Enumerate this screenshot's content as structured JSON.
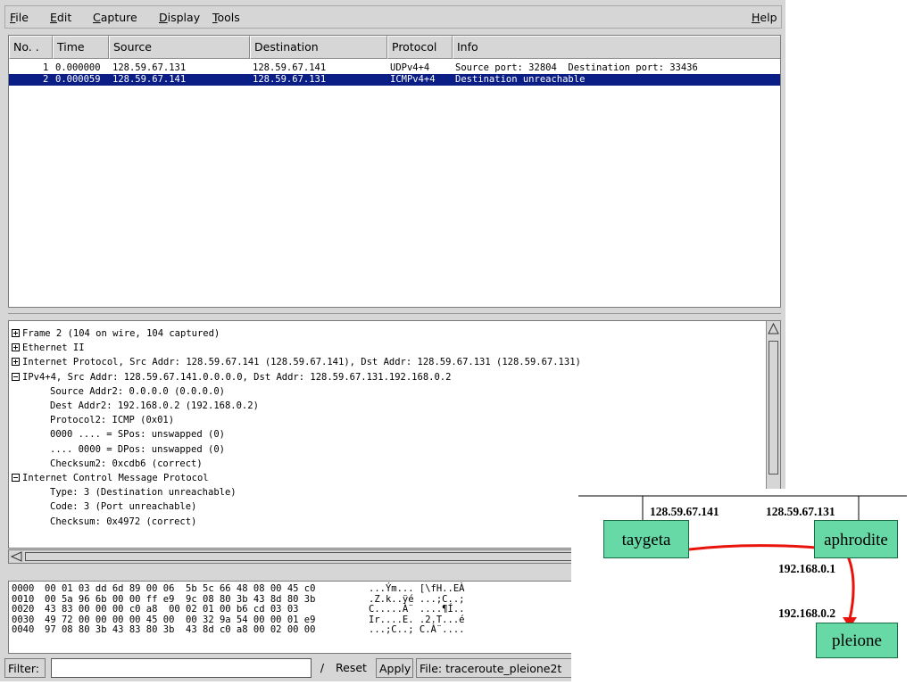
{
  "menubar": {
    "items": [
      {
        "label": "File",
        "key": "F",
        "rest": "ile"
      },
      {
        "label": "Edit",
        "key": "E",
        "rest": "dit"
      },
      {
        "label": "Capture",
        "key": "C",
        "rest": "apture"
      },
      {
        "label": "Display",
        "key": "D",
        "rest": "isplay"
      },
      {
        "label": "Tools",
        "key": "T",
        "rest": "ools"
      }
    ],
    "help": {
      "label": "Help",
      "key": "H",
      "rest": "elp"
    }
  },
  "packet_list": {
    "columns": [
      "No. .",
      "Time",
      "Source",
      "Destination",
      "Protocol",
      "Info"
    ],
    "rows": [
      {
        "no": "1",
        "time": "0.000000",
        "source": "128.59.67.131",
        "destination": "128.59.67.141",
        "protocol": "UDPv4+4",
        "info": "Source port: 32804  Destination port: 33436",
        "selected": false
      },
      {
        "no": "2",
        "time": "0.000059",
        "source": "128.59.67.141",
        "destination": "128.59.67.131",
        "protocol": "ICMPv4+4",
        "info": "Destination unreachable",
        "selected": true
      }
    ]
  },
  "details": {
    "lines": [
      {
        "toggle": "plus",
        "text": "Frame 2 (104 on wire, 104 captured)"
      },
      {
        "toggle": "plus",
        "text": "Ethernet II"
      },
      {
        "toggle": "plus",
        "text": "Internet Protocol, Src Addr: 128.59.67.141 (128.59.67.141), Dst Addr: 128.59.67.131 (128.59.67.131)"
      },
      {
        "toggle": "minus",
        "text": "IPv4+4, Src Addr: 128.59.67.141.0.0.0.0, Dst Addr: 128.59.67.131.192.168.0.2"
      },
      {
        "toggle": "",
        "text": "Source Addr2: 0.0.0.0 (0.0.0.0)"
      },
      {
        "toggle": "",
        "text": "Dest Addr2: 192.168.0.2 (192.168.0.2)"
      },
      {
        "toggle": "",
        "text": "Protocol2: ICMP (0x01)"
      },
      {
        "toggle": "",
        "text": "0000 .... = SPos: unswapped (0)"
      },
      {
        "toggle": "",
        "text": ".... 0000 = DPos: unswapped (0)"
      },
      {
        "toggle": "",
        "text": "Checksum2: 0xcdb6 (correct)"
      },
      {
        "toggle": "minus",
        "text": "Internet Control Message Protocol"
      },
      {
        "toggle": "",
        "text": "Type: 3 (Destination unreachable)"
      },
      {
        "toggle": "",
        "text": "Code: 3 (Port unreachable)"
      },
      {
        "toggle": "",
        "text": "Checksum: 0x4972 (correct)"
      }
    ]
  },
  "bytes": {
    "rows": [
      {
        "offset": "0000",
        "hex": "00 01 03 dd 6d 89 00 06  5b 5c 66 48 08 00 45 c0",
        "ascii": "...Ým... [\\fH..EÀ"
      },
      {
        "offset": "0010",
        "hex": "00 5a 96 6b 00 00 ff e9  9c 08 80 3b 43 8d 80 3b",
        "ascii": ".Z.k..ÿé ...;C..;"
      },
      {
        "offset": "0020",
        "hex": "43 83 00 00 00 c0 a8  00 02 01 00 b6 cd 03 03",
        "ascii": "C.....À¨ ....¶Í.."
      },
      {
        "offset": "0030",
        "hex": "49 72 00 00 00 00 45 00  00 32 9a 54 00 00 01 e9",
        "ascii": "Ir....E. .2.T...é"
      },
      {
        "offset": "0040",
        "hex": "97 08 80 3b 43 83 80 3b  43 8d c0 a8 00 02 00 00",
        "ascii": "...;C..; C.À¨...."
      }
    ]
  },
  "filterbar": {
    "label": "Filter:",
    "value": "",
    "clear_glyph": "/",
    "reset": "Reset",
    "apply": "Apply",
    "file": "File: traceroute_pleione2t"
  },
  "diagram": {
    "nodes": {
      "taygeta": "taygeta",
      "aphrodite": "aphrodite",
      "pleione": "pleione"
    },
    "ips": {
      "taygeta_top": "128.59.67.141",
      "aphrodite_top": "128.59.67.131",
      "aphrodite_bottom": "192.168.0.1",
      "pleione_top": "192.168.0.2"
    },
    "arrow_color": "#e8140c",
    "node_color": "#66d9a6"
  },
  "colors": {
    "selection": "#0a1e86",
    "chrome": "#d6d6d6"
  }
}
